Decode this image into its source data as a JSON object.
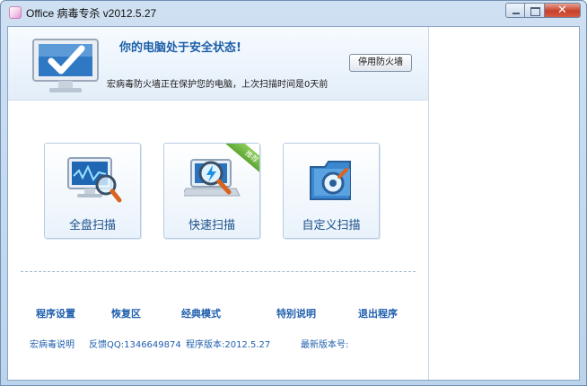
{
  "window": {
    "title": "Office 病毒专杀 v2012.5.27",
    "close_glyph": "✕"
  },
  "header": {
    "status_title": "你的电脑处于安全状态!",
    "status_sub": "宏病毒防火墙正在保护您的电脑，上次扫描时间是0天前",
    "firewall_button": "停用防火墙"
  },
  "scan_tiles": [
    {
      "label": "全盘扫描",
      "icon": "monitor-magnifier-icon"
    },
    {
      "label": "快速扫描",
      "icon": "laptop-lightning-icon",
      "ribbon": "推荐"
    },
    {
      "label": "自定义扫描",
      "icon": "folder-target-icon"
    }
  ],
  "footer_links": [
    "程序设置",
    "恢复区",
    "经典模式",
    "特别说明",
    "退出程序"
  ],
  "footer_info": {
    "help": "宏病毒说明",
    "feedback": "反馈QQ:1346649874",
    "version": "程序版本:2012.5.27",
    "latest": "最新版本号:"
  },
  "colors": {
    "accent": "#1f5fae",
    "title_bar": "#cfe0f2",
    "close_button": "#c7402a",
    "ribbon": "#6cb43d"
  }
}
